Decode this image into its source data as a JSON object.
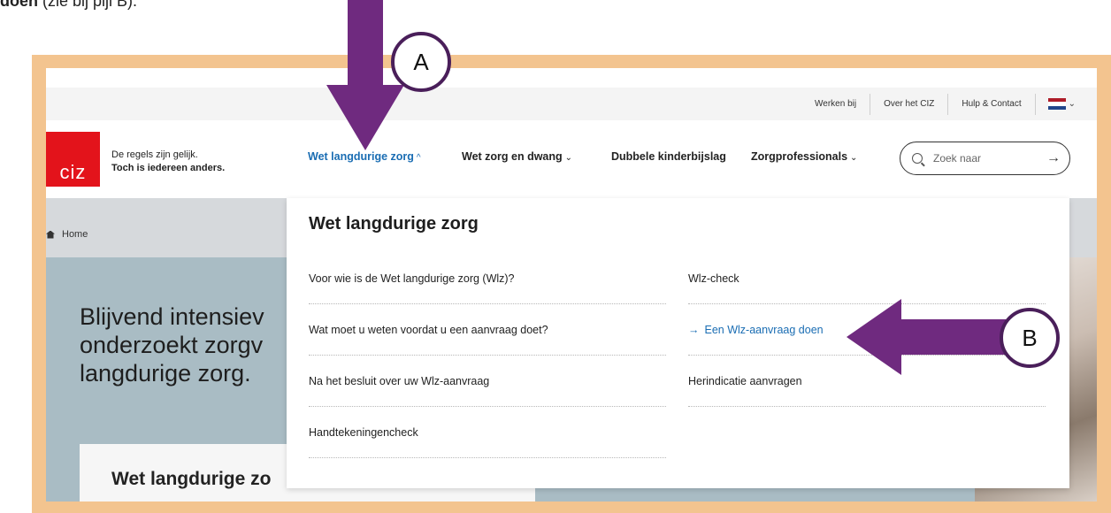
{
  "intro": {
    "bold": "doen",
    "rest": " (zie bij pijl B)."
  },
  "util_bar": {
    "links": [
      "Werken bij",
      "Over het CIZ",
      "Hulp & Contact"
    ],
    "language_flag_icon": "dutch-flag-icon"
  },
  "header": {
    "logo_text": "ciz",
    "tagline_line1": "De regels zijn gelijk.",
    "tagline_line2": "Toch is iedereen anders.",
    "nav": [
      {
        "label": "Wet langdurige zorg",
        "active": true
      },
      {
        "label": "Wet zorg en dwang",
        "active": false
      },
      {
        "label": "Dubbele kinderbijslag",
        "active": false
      },
      {
        "label": "Zorgprofessionals",
        "active": false
      }
    ],
    "search_placeholder": "Zoek naar"
  },
  "breadcrumb": {
    "home_label": "Home"
  },
  "hero": {
    "title_line1": "Blijvend intensiev",
    "title_line2": "onderzoekt zorgv",
    "title_line3": "langdurige zorg.",
    "box_title": "Wet langdurige zo"
  },
  "mega_menu": {
    "title": "Wet langdurige zorg",
    "left_items": [
      "Voor wie is de Wet langdurige zorg (Wlz)?",
      "Wat moet u weten voordat u een aanvraag doet?",
      "Na het besluit over uw Wlz-aanvraag",
      "Handtekeningencheck"
    ],
    "right_items": [
      "Wlz-check",
      "Een Wlz-aanvraag doen",
      "Herindicatie aanvragen"
    ]
  },
  "annotations": {
    "a": "A",
    "b": "B"
  },
  "colors": {
    "frame": "#f3c48f",
    "brand_red": "#e3131b",
    "link_blue": "#1a6db3",
    "annotation_purple": "#6f2a7f"
  }
}
